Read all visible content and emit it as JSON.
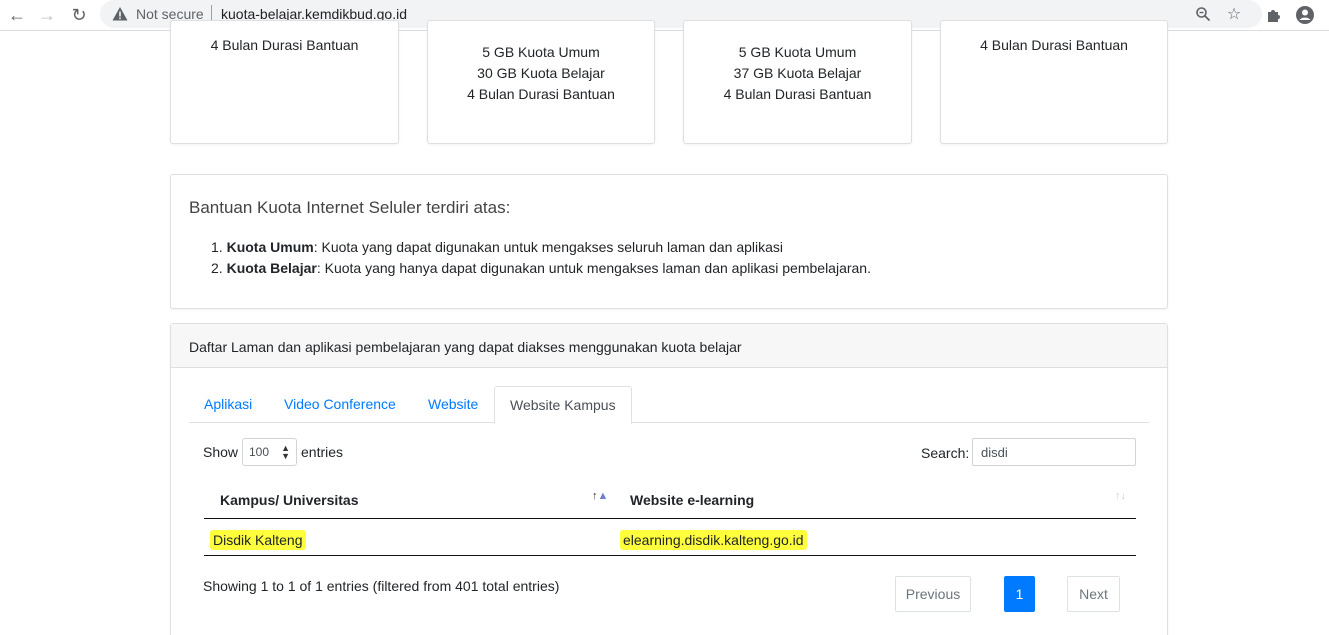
{
  "browser": {
    "security_label": "Not secure",
    "url": "kuota-belajar.kemdikbud.go.id"
  },
  "packages": [
    {
      "lines": [
        "4 Bulan Durasi Bantuan"
      ]
    },
    {
      "lines": [
        "5 GB Kuota Umum",
        "30 GB Kuota Belajar",
        "4 Bulan Durasi Bantuan"
      ]
    },
    {
      "lines": [
        "5 GB Kuota Umum",
        "37 GB Kuota Belajar",
        "4 Bulan Durasi Bantuan"
      ]
    },
    {
      "lines": [
        "4 Bulan Durasi Bantuan"
      ]
    }
  ],
  "info": {
    "title": "Bantuan Kuota Internet Seluler terdiri atas:",
    "items": [
      {
        "num": "1.",
        "term": "Kuota Umum",
        "desc": ": Kuota yang dapat digunakan untuk mengakses seluruh laman dan aplikasi"
      },
      {
        "num": "2.",
        "term": "Kuota Belajar",
        "desc": ": Kuota yang hanya dapat digunakan untuk mengakses laman dan aplikasi pembelajaran."
      }
    ]
  },
  "list_card": {
    "header": "Daftar Laman dan aplikasi pembelajaran yang dapat diakses menggunakan kuota belajar",
    "tabs": [
      {
        "label": "Aplikasi",
        "active": false
      },
      {
        "label": "Video Conference",
        "active": false
      },
      {
        "label": "Website",
        "active": false
      },
      {
        "label": "Website Kampus",
        "active": true
      }
    ],
    "show_label": "Show",
    "entries_value": "100",
    "entries_label": "entries",
    "search_label": "Search:",
    "search_value": "disdi",
    "columns": [
      "Kampus/ Universitas",
      "Website e-learning"
    ],
    "rows": [
      {
        "kampus": "Disdik Kalteng",
        "website": "elearning.disdik.kalteng.go.id"
      }
    ],
    "info_text": "Showing 1 to 1 of 1 entries (filtered from 401 total entries)",
    "pager": {
      "previous": "Previous",
      "current": "1",
      "next": "Next"
    }
  },
  "colors": {
    "link": "#007bff",
    "highlight": "#ffff3b",
    "active_page": "#007bff"
  }
}
